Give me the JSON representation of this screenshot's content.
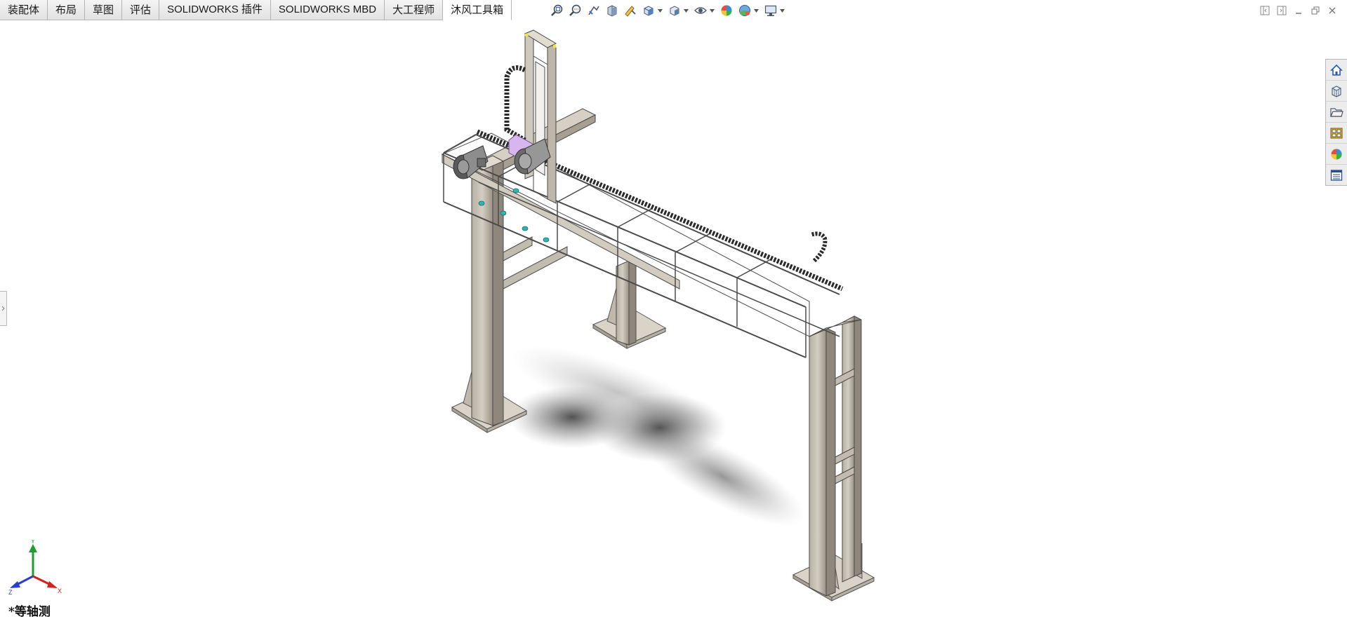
{
  "tabs": [
    {
      "label": "装配体"
    },
    {
      "label": "布局"
    },
    {
      "label": "草图"
    },
    {
      "label": "评估"
    },
    {
      "label": "SOLIDWORKS 插件"
    },
    {
      "label": "SOLIDWORKS MBD"
    },
    {
      "label": "大工程师"
    },
    {
      "label": "沐风工具箱"
    }
  ],
  "active_tab": "沐风工具箱",
  "view_toolbar": {
    "icons": [
      "zoom-to-fit-icon",
      "zoom-to-area-icon",
      "previous-view-icon",
      "section-view-icon",
      "dynamic-annotation-icon",
      "view-orientation-icon",
      "display-style-icon",
      "hide-show-items-icon",
      "edit-appearance-icon",
      "apply-scene-icon",
      "view-settings-icon"
    ]
  },
  "task_pane": {
    "icons": [
      "solidworks-resources-icon",
      "design-library-icon",
      "file-explorer-icon",
      "view-palette-icon",
      "appearances-scenes-icon",
      "custom-properties-icon"
    ]
  },
  "triad": {
    "x_label": "X",
    "y_label": "Y",
    "z_label": "Z",
    "colors": {
      "x": "#d42020",
      "y": "#1e9e2e",
      "z": "#2a3fd0"
    }
  },
  "view_name": "*等轴测",
  "colors": {
    "frame": "#c9c2b6",
    "frame_dark": "#8f877b",
    "accent_purple": "#d7b6ef",
    "cyan": "#2fb5b5"
  }
}
